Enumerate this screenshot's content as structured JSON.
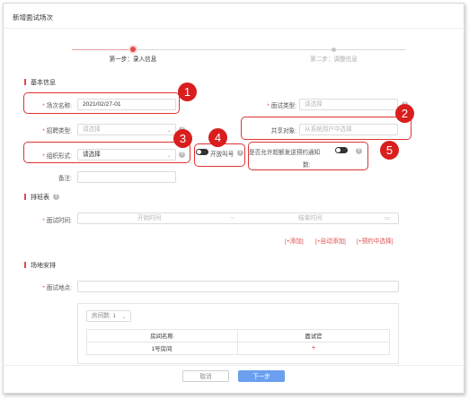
{
  "dialog": {
    "title": "新增面试场次"
  },
  "steps": [
    {
      "label": "第一步：录入信息"
    },
    {
      "label": "第二步：调整信息"
    }
  ],
  "sections": {
    "basic": "基本信息",
    "schedule": "排班表",
    "venue": "场地安排"
  },
  "basic": {
    "session_name": {
      "label": "场次名称:",
      "value": "2021/02/27-01"
    },
    "interview_type": {
      "label": "面试类型:",
      "placeholder": "请选择"
    },
    "recruit_type": {
      "label": "招聘类型:",
      "placeholder": "请选择"
    },
    "share_target": {
      "label": "共享对象:",
      "placeholder": "从系统用户中选择"
    },
    "org_form": {
      "label": "组织形式:",
      "placeholder": "请选择"
    },
    "open_call": {
      "label": "开放叫号"
    },
    "allow_over": {
      "label": "是否允许超额发送预约通知",
      "label2": "数:"
    },
    "remark": {
      "label": "备注:"
    }
  },
  "schedule": {
    "time_label": "面试时间:",
    "start_placeholder": "开始时间",
    "end_placeholder": "结束时间",
    "sep": "~",
    "links": [
      "[+添加]",
      "[+自动添加]",
      "[+预约中选择]"
    ]
  },
  "venue": {
    "place_label": "面试地点:",
    "room_count": "房间数: 1",
    "table": {
      "headers": [
        "房间名称",
        "面试官"
      ],
      "rows": [
        {
          "room": "1号房间",
          "interviewer": "+"
        }
      ]
    }
  },
  "buttons": {
    "cancel": "取消",
    "next": "下一步"
  },
  "badges": [
    "1",
    "2",
    "3",
    "4",
    "5"
  ],
  "icons": {
    "help": "question-circle-icon",
    "chevron": "chevron-down-icon",
    "calendar": "calendar-icon",
    "toggle": "toggle-switch"
  },
  "colors": {
    "accent": "#e04b4b",
    "annotation": "#d91e1e",
    "primary_button": "#6b9ff0"
  }
}
